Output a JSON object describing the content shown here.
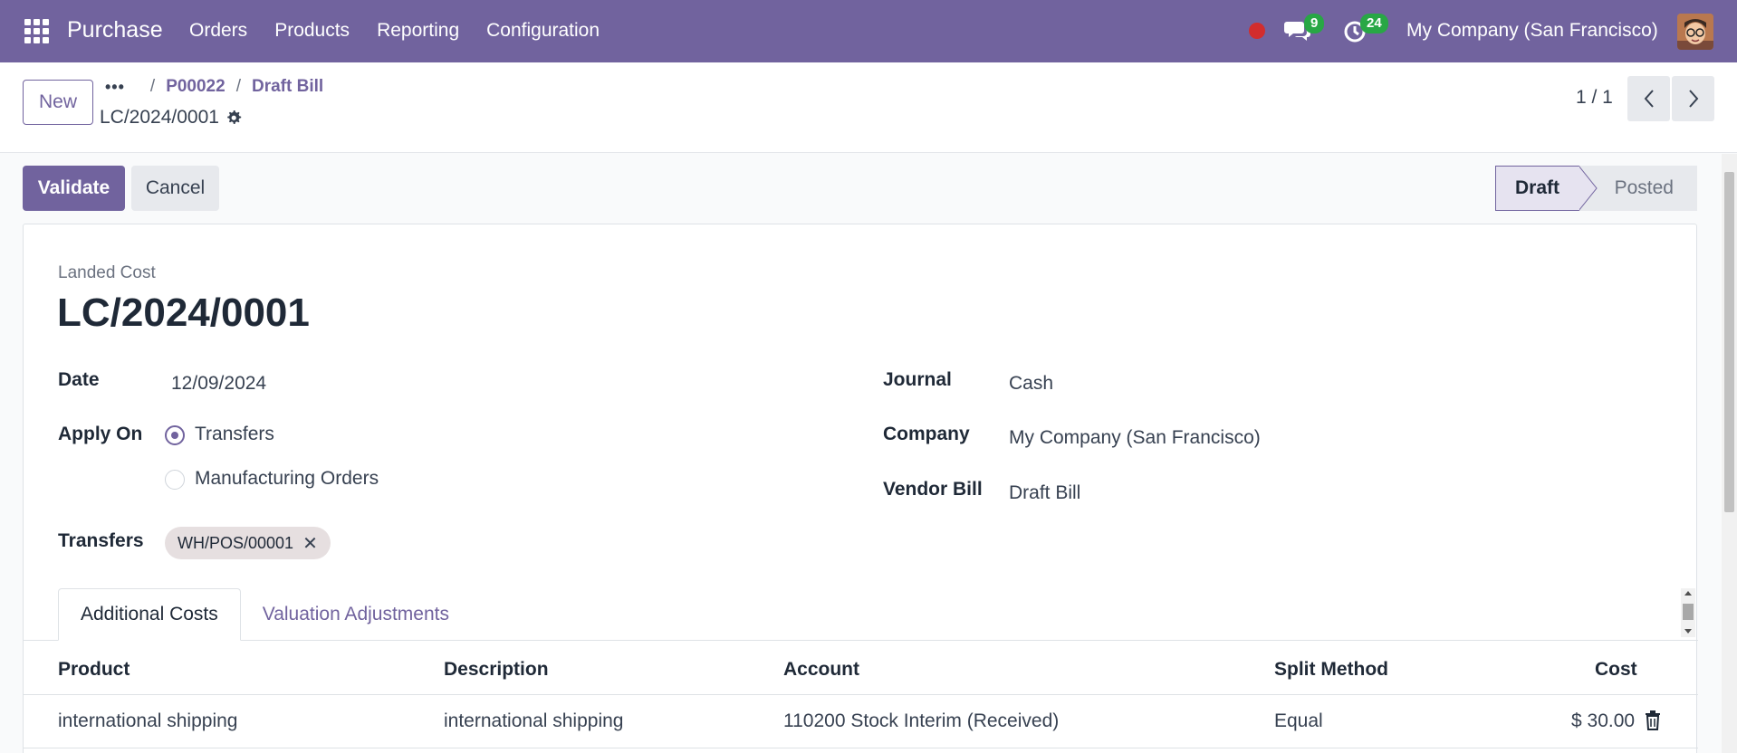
{
  "navbar": {
    "brand": "Purchase",
    "menu": [
      "Orders",
      "Products",
      "Reporting",
      "Configuration"
    ],
    "chat_count": "9",
    "activity_count": "24",
    "company": "My Company (San Francisco)"
  },
  "control": {
    "new_label": "New",
    "breadcrumb": [
      "P00022",
      "Draft Bill"
    ],
    "record": "LC/2024/0001",
    "pager": "1 / 1"
  },
  "actions": {
    "validate": "Validate",
    "cancel": "Cancel"
  },
  "status": {
    "stages": [
      "Draft",
      "Posted"
    ],
    "current": "Draft"
  },
  "form": {
    "subtitle": "Landed Cost",
    "name": "LC/2024/0001",
    "date_label": "Date",
    "date": "12/09/2024",
    "apply_on_label": "Apply On",
    "apply_on_options": [
      "Transfers",
      "Manufacturing Orders"
    ],
    "apply_on_selected": "Transfers",
    "transfers_label": "Transfers",
    "transfer_tag": "WH/POS/00001",
    "journal_label": "Journal",
    "journal": "Cash",
    "company_label": "Company",
    "company": "My Company (San Francisco)",
    "vendor_bill_label": "Vendor Bill",
    "vendor_bill": "Draft Bill"
  },
  "tabs": [
    "Additional Costs",
    "Valuation Adjustments"
  ],
  "table": {
    "headers": [
      "Product",
      "Description",
      "Account",
      "Split Method",
      "Cost"
    ],
    "rows": [
      [
        "international shipping",
        "international shipping",
        "110200 Stock Interim (Received)",
        "Equal",
        "$ 30.00"
      ]
    ]
  }
}
